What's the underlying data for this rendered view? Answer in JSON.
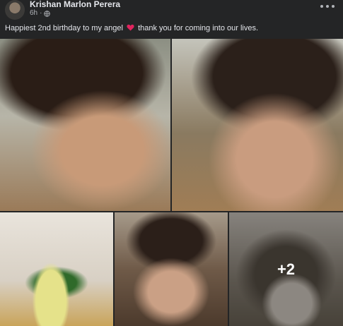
{
  "post": {
    "author": "Krishan Marlon Perera",
    "time": "6h",
    "separator": "·",
    "caption_before": "Happiest 2nd birthday to my angel",
    "caption_after": "thank you for coming into our lives.",
    "icons": {
      "avatar": "profile-avatar",
      "privacy": "globe-icon",
      "options": "more-options-icon",
      "emoji": "red-heart-icon"
    },
    "colors": {
      "heart": "#e0245e",
      "text": "#e4e6eb",
      "muted": "#b0b3b8",
      "background": "#242526"
    }
  },
  "photos": {
    "items": [
      {
        "description": "toddler closeup eyes closed"
      },
      {
        "description": "toddler smiling tongue out"
      },
      {
        "description": "toddler with sunglasses"
      },
      {
        "description": "toddler hands on cheeks"
      },
      {
        "description": "man holding baby"
      }
    ],
    "more_count": "+2"
  }
}
